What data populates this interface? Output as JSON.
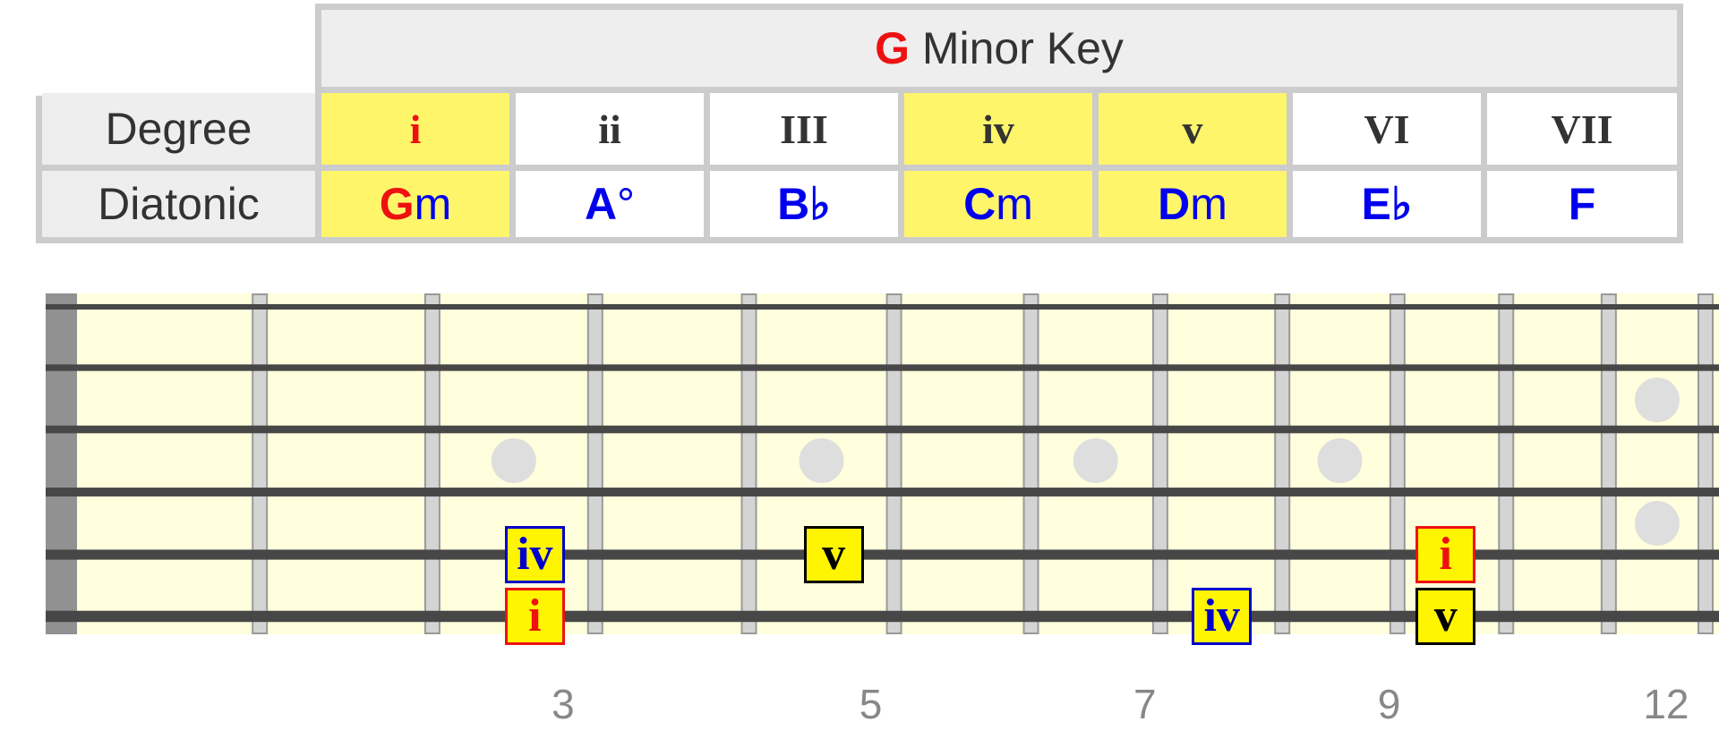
{
  "key": {
    "root": "G",
    "title_rest": " Minor Key"
  },
  "rows": {
    "degree_label": "Degree",
    "diatonic_label": "Diatonic"
  },
  "columns": [
    {
      "degree": "i",
      "chord_root": "G",
      "chord_quality": "m",
      "highlighted": true,
      "root_is_tonic": true
    },
    {
      "degree": "ii",
      "chord_root": "A",
      "chord_quality": "°",
      "highlighted": false,
      "root_is_tonic": false
    },
    {
      "degree": "III",
      "chord_root": "B♭",
      "chord_quality": "",
      "highlighted": false,
      "root_is_tonic": false
    },
    {
      "degree": "iv",
      "chord_root": "C",
      "chord_quality": "m",
      "highlighted": true,
      "root_is_tonic": false
    },
    {
      "degree": "v",
      "chord_root": "D",
      "chord_quality": "m",
      "highlighted": true,
      "root_is_tonic": false
    },
    {
      "degree": "VI",
      "chord_root": "E♭",
      "chord_quality": "",
      "highlighted": false,
      "root_is_tonic": false
    },
    {
      "degree": "VII",
      "chord_root": "F",
      "chord_quality": "",
      "highlighted": false,
      "root_is_tonic": false
    }
  ],
  "fretboard": {
    "frets": 12,
    "strings": 6,
    "inlay_frets": [
      3,
      5,
      7,
      9,
      12
    ],
    "fret_numbers": [
      "3",
      "5",
      "7",
      "9",
      "12"
    ],
    "markers": [
      {
        "label": "iv",
        "string": 5,
        "fret": 3,
        "color": "#0000cc"
      },
      {
        "label": "i",
        "string": 6,
        "fret": 3,
        "color": "#ee1111"
      },
      {
        "label": "v",
        "string": 5,
        "fret": 5,
        "color": "#000000"
      },
      {
        "label": "iv",
        "string": 6,
        "fret": 8,
        "color": "#0000cc"
      },
      {
        "label": "i",
        "string": 5,
        "fret": 10,
        "color": "#ee1111"
      },
      {
        "label": "v",
        "string": 6,
        "fret": 10,
        "color": "#000000"
      }
    ]
  },
  "colors": {
    "highlight": "#fff56b",
    "tonic": "#ee1111",
    "chord": "#0000ee",
    "board": "#ffffdd",
    "marker_fill": "#fff500"
  }
}
